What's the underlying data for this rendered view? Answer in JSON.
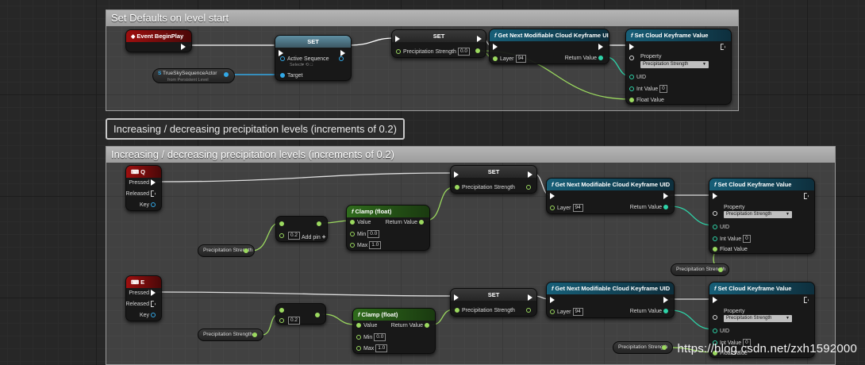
{
  "comments": {
    "defaults": "Set Defaults on level start",
    "precip_bubble": "Increasing / decreasing precipitation levels (increments of 0.2)",
    "precip": "Increasing / decreasing precipitation levels (increments of 0.2)"
  },
  "top": {
    "event_begin_play": "Event BeginPlay",
    "set_node": {
      "title": "SET",
      "active_sequence": "Active Sequence",
      "active_sequence_value": "Select▾ ⟲ □",
      "target": "Target"
    },
    "actor_ref": {
      "label": "TrueSkySequenceActor",
      "sub": "from Persistent Level"
    },
    "set_precip": {
      "title": "SET",
      "pin": "Precipitation Strength",
      "value": "0.0"
    },
    "get_uid": {
      "title": "Get Next Modifiable Cloud Keyframe UID",
      "layer_label": "Layer",
      "layer_value": "94",
      "return": "Return Value"
    },
    "set_cloud": {
      "title": "Set Cloud Keyframe Value",
      "property": "Property",
      "property_value": "Precipitation Strength",
      "uid": "UID",
      "int_value": "Int Value",
      "int_value_val": "0",
      "float_value": "Float Value"
    }
  },
  "q_row": {
    "key": "Q",
    "pressed": "Pressed",
    "released": "Released",
    "keypin": "Key",
    "getter": "Precipitation Strength",
    "add": {
      "value": "0.2",
      "add_pin": "Add pin"
    },
    "clamp": {
      "title": "Clamp (float)",
      "value": "Value",
      "return": "Return Value",
      "min": "Min",
      "min_val": "0.0",
      "max": "Max",
      "max_val": "1.0"
    },
    "set": {
      "title": "SET",
      "pin": "Precipitation Strength"
    },
    "get_uid": {
      "title": "Get Next Modifiable Cloud Keyframe UID",
      "layer": "Layer",
      "layer_value": "94",
      "return": "Return Value"
    },
    "set_cloud": {
      "title": "Set Cloud Keyframe Value",
      "property": "Property",
      "property_value": "Precipitation Strength",
      "uid": "UID",
      "int_value": "Int Value",
      "int_value_val": "0",
      "float_value": "Float Value"
    },
    "getter2": "Precipitation Strength"
  },
  "e_row": {
    "key": "E",
    "pressed": "Pressed",
    "released": "Released",
    "keypin": "Key",
    "getter": "Precipitation Strength",
    "sub": {
      "value": "0.2"
    },
    "clamp": {
      "title": "Clamp (float)",
      "value": "Value",
      "return": "Return Value",
      "min": "Min",
      "min_val": "0.0",
      "max": "Max",
      "max_val": "1.0"
    },
    "set": {
      "title": "SET",
      "pin": "Precipitation Strength"
    },
    "get_uid": {
      "title": "Get Next Modifiable Cloud Keyframe UID",
      "layer": "Layer",
      "layer_value": "94",
      "return": "Return Value"
    },
    "set_cloud": {
      "title": "Set Cloud Keyframe Value",
      "property": "Property",
      "property_value": "Precipitation Strength",
      "uid": "UID",
      "int_value": "Int Value",
      "int_value_val": "0",
      "float_value": "Float Value"
    },
    "getter2": "Precipitation Strength"
  },
  "watermark": "https://blog.csdn.net/zxh1592000",
  "colors": {
    "float_pin": "#9bd95f",
    "uid_pin": "#2ed3a8",
    "object_pin": "#32a8e6",
    "exec": "#ffffff",
    "event_header": "#9e0f0f",
    "function_header": "#175f78"
  }
}
